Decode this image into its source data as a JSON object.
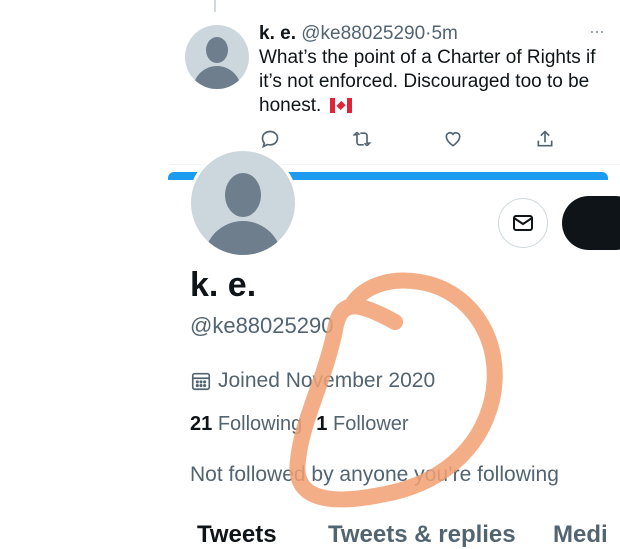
{
  "tweet": {
    "author_name": "k. e.",
    "author_handle": "@ke88025290",
    "separator": "·",
    "time": "5m",
    "more": "···",
    "text": "What’s the point of a Charter of Rights if it’s not enforced. Discouraged too to be honest.",
    "emoji": "canada-flag-icon"
  },
  "profile": {
    "display_name": "k. e.",
    "handle": "@ke88025290",
    "joined": "Joined November 2020",
    "following_count": "21",
    "following_label": "Following",
    "followers_count": "1",
    "followers_label": "Follower",
    "not_followed": "Not followed by anyone you’re following"
  },
  "tabs": [
    {
      "label": "Tweets",
      "active": true
    },
    {
      "label": "Tweets & replies",
      "active": false
    },
    {
      "label": "Medi",
      "active": false
    }
  ],
  "colors": {
    "accent": "#1d9bf0",
    "annotation": "#f2a072"
  }
}
